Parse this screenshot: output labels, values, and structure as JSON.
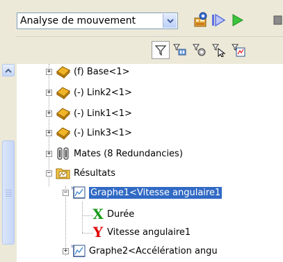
{
  "toolbar": {
    "study_type": "Analyse de mouvement",
    "buttons": [
      {
        "name": "calculate-icon"
      },
      {
        "name": "play-from-start-icon"
      },
      {
        "name": "play-icon"
      },
      {
        "name": "stop-icon"
      }
    ]
  },
  "filter_icons": [
    {
      "name": "filter-icon",
      "active": true
    },
    {
      "name": "filter-animation-icon",
      "active": false
    },
    {
      "name": "filter-driving-icon",
      "active": false
    },
    {
      "name": "filter-selected-icon",
      "active": false
    },
    {
      "name": "filter-results-icon",
      "active": false
    }
  ],
  "tree": {
    "items": [
      {
        "label": "(f) Base<1>",
        "icon": "part-icon"
      },
      {
        "label": "(-) Link2<1>",
        "icon": "part-icon"
      },
      {
        "label": "(-) Link1<1>",
        "icon": "part-icon"
      },
      {
        "label": "(-) Link3<1>",
        "icon": "part-icon"
      },
      {
        "label": "Mates (8 Redundancies)",
        "icon": "mates-icon"
      },
      {
        "label": "Résultats",
        "icon": "results-folder-icon"
      },
      {
        "label": "Graphe1<Vitesse angulaire1",
        "icon": "graph-icon",
        "selected": true
      },
      {
        "label": "Durée",
        "icon": "x-axis-icon"
      },
      {
        "label": "Vitesse angulaire1",
        "icon": "y-axis-icon"
      },
      {
        "label": "Graphe2<Accélération angu",
        "icon": "graph-icon"
      }
    ],
    "x_axis_letter": "X",
    "y_axis_letter": "Y"
  },
  "colors": {
    "selection": "#316ac5",
    "toolbar_bg": "#ece9d8",
    "x_axis_green": "#1a9a1a",
    "y_axis_red": "#e00000"
  }
}
